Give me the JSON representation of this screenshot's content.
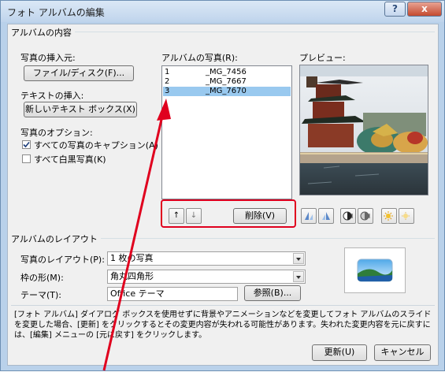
{
  "title": "フォト アルバムの編集",
  "titlebar_buttons": {
    "help": "?",
    "close": "x"
  },
  "content_section": {
    "label": "アルバムの内容",
    "insert_photo_label": "写真の挿入元:",
    "file_disk_button": "ファイル/ディスク(F)...",
    "insert_text_label": "テキストの挿入:",
    "new_textbox_button": "新しいテキスト ボックス(X)",
    "options_label": "写真のオプション:",
    "caption_checkbox": {
      "label": "すべての写真のキャプション(A)",
      "checked": true
    },
    "bw_checkbox": {
      "label": "すべて白黒写真(K)",
      "checked": false
    }
  },
  "photos": {
    "label": "アルバムの写真(R):",
    "items": [
      {
        "num": "1",
        "name": "_MG_7456",
        "selected": false
      },
      {
        "num": "2",
        "name": "_MG_7667",
        "selected": false
      },
      {
        "num": "3",
        "name": "_MG_7670",
        "selected": true
      }
    ],
    "up_button": "↑",
    "down_button": "↓",
    "delete_button": "削除(V)"
  },
  "preview": {
    "label": "プレビュー:"
  },
  "layout_section": {
    "label": "アルバムのレイアウト",
    "picture_layout_label": "写真のレイアウト(P):",
    "picture_layout_value": "1 枚の写真",
    "frame_shape_label": "枠の形(M):",
    "frame_shape_value": "角丸四角形",
    "theme_label": "テーマ(T):",
    "theme_value": "Office テーマ",
    "browse_button": "参照(B)..."
  },
  "notice": "[フォト アルバム] ダイアログ ボックスを使用せずに背景やアニメーションなどを変更してフォト アルバムのスライドを変更した場合、[更新] をクリックするとその変更内容が失われる可能性があります。失われた変更内容を元に戻すには、[編集] メニューの [元に戻す] をクリックします。",
  "footer": {
    "update_button": "更新(U)",
    "cancel_button": "キャンセル"
  },
  "colors": {
    "annotation": "#e0001e",
    "selection": "#99c9ef",
    "title_bar": "#bfd4ec"
  }
}
